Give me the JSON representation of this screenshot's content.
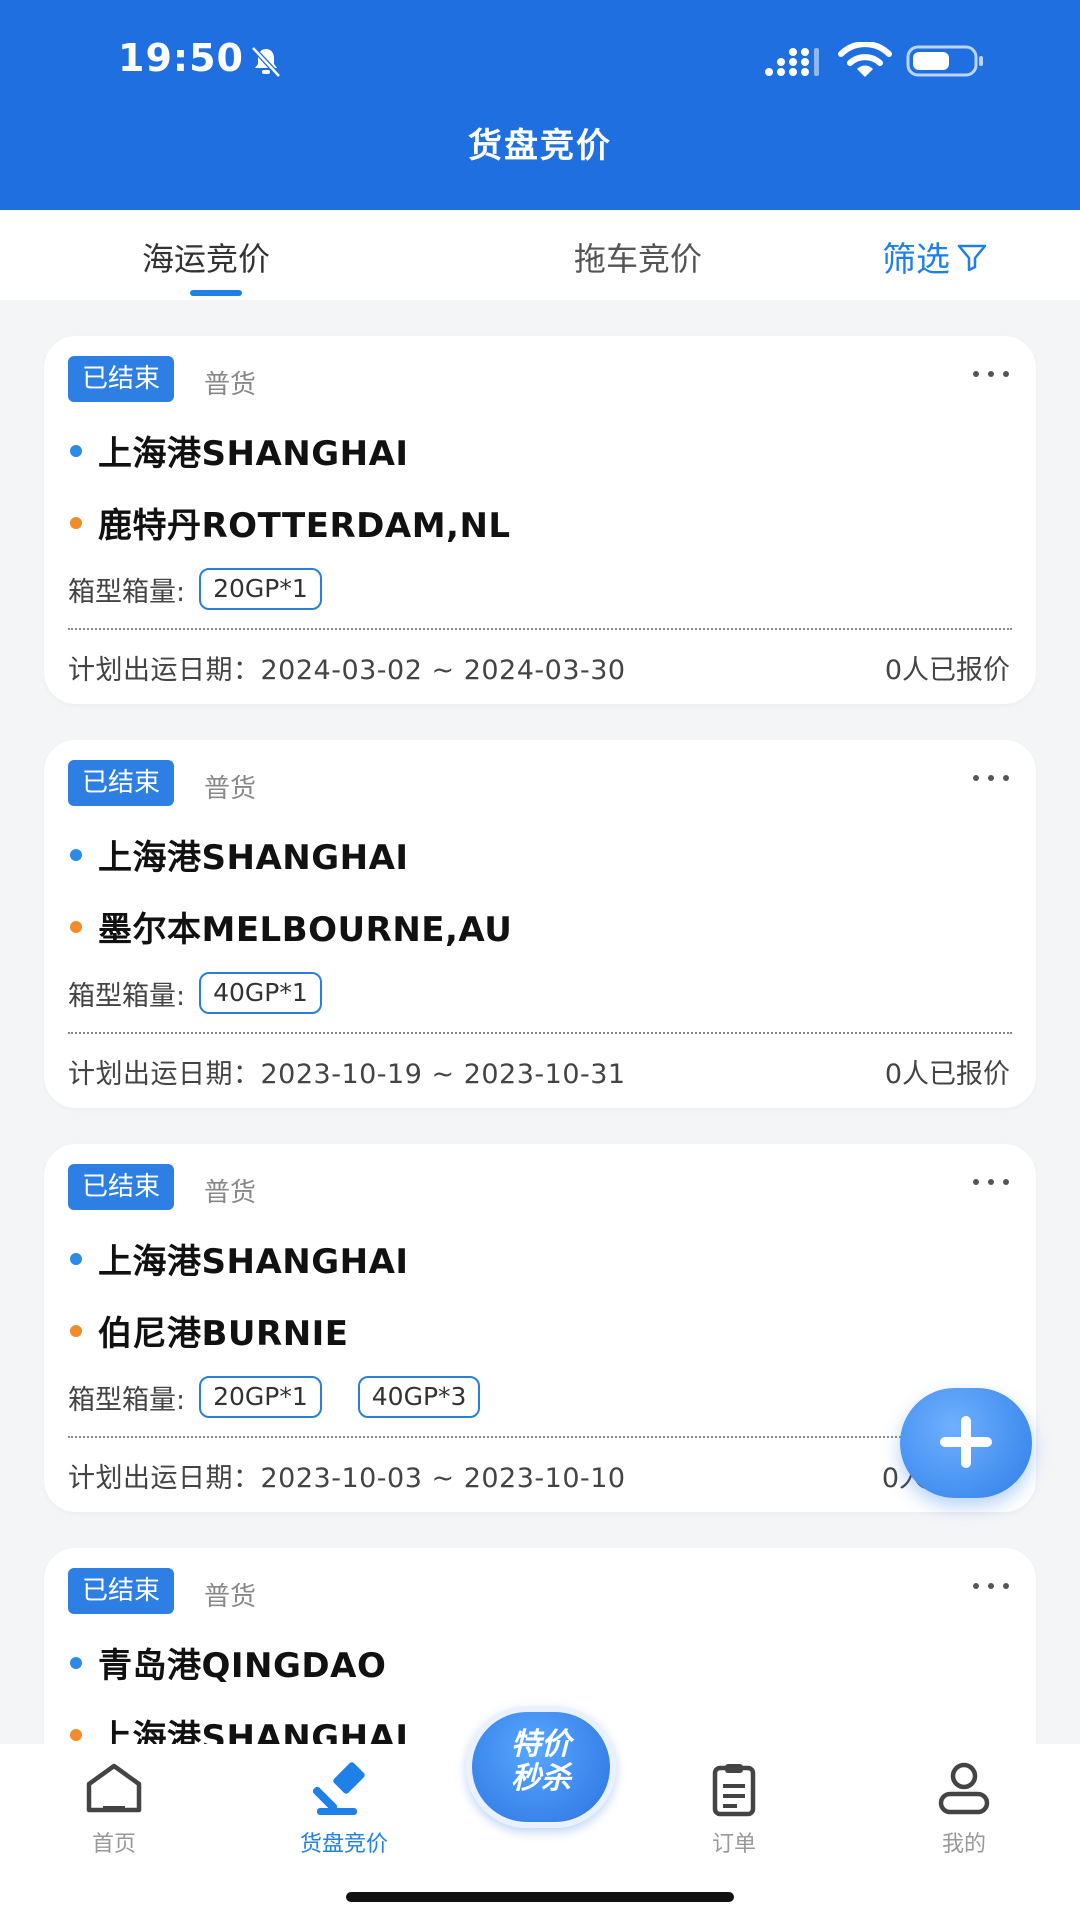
{
  "status_bar": {
    "time": "19:50"
  },
  "header": {
    "title": "货盘竞价"
  },
  "tabs": {
    "sea": "海运竞价",
    "truck": "拖车竞价",
    "filter": "筛选"
  },
  "cards": [
    {
      "status": "已结束",
      "cargo": "普货",
      "from": "上海港SHANGHAI",
      "to": "鹿特丹ROTTERDAM,NL",
      "container_label": "箱型箱量:",
      "containers": [
        "20GP*1"
      ],
      "dates": "计划出运日期：2024-03-02 ~ 2024-03-30",
      "quotes": "0人已报价"
    },
    {
      "status": "已结束",
      "cargo": "普货",
      "from": "上海港SHANGHAI",
      "to": "墨尔本MELBOURNE,AU",
      "container_label": "箱型箱量:",
      "containers": [
        "40GP*1"
      ],
      "dates": "计划出运日期：2023-10-19 ~ 2023-10-31",
      "quotes": "0人已报价"
    },
    {
      "status": "已结束",
      "cargo": "普货",
      "from": "上海港SHANGHAI",
      "to": "伯尼港BURNIE",
      "container_label": "箱型箱量:",
      "containers": [
        "20GP*1",
        "40GP*3"
      ],
      "dates": "计划出运日期：2023-10-03 ~ 2023-10-10",
      "quotes": "0人"
    },
    {
      "status": "已结束",
      "cargo": "普货",
      "from": "青岛港QINGDAO",
      "to": "上海港SHANGHAI"
    }
  ],
  "promo": {
    "line1": "特价",
    "line2": "秒杀"
  },
  "nav": {
    "home": "首页",
    "bidding": "货盘竞价",
    "orders": "订单",
    "mine": "我的"
  },
  "colors": {
    "primary": "#1f6fe0",
    "accent": "#1f80e8",
    "dot_from": "#2b8be6",
    "dot_to": "#f08c2a"
  }
}
